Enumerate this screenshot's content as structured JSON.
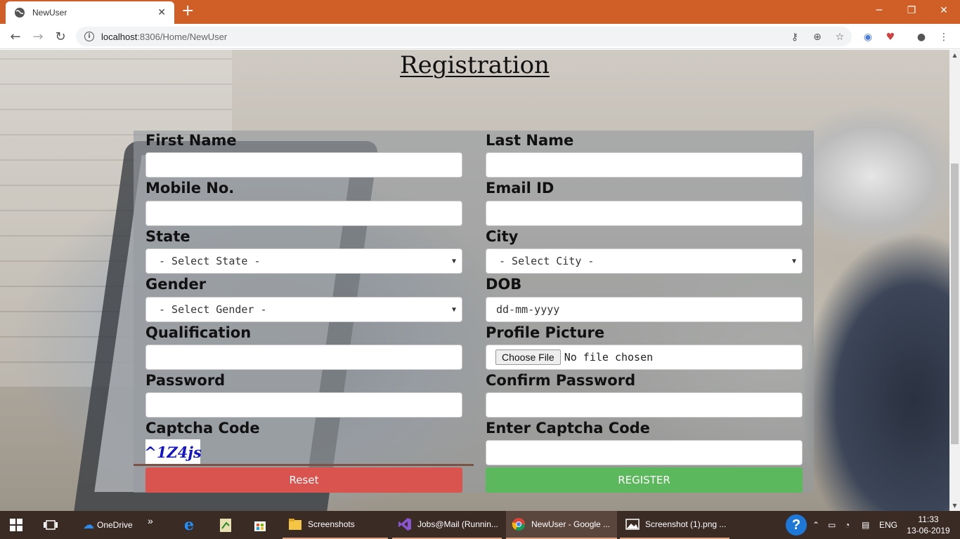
{
  "browser": {
    "tab_title": "NewUser",
    "tab_close": "✕",
    "new_tab": "+",
    "url_host": "localhost",
    "url_path": ":8306/Home/NewUser",
    "window_controls": {
      "minimize": "─",
      "restore": "❐",
      "close": "✕"
    }
  },
  "page": {
    "heading": "Registration",
    "form": {
      "first_name_label": "First Name",
      "last_name_label": "Last Name",
      "mobile_label": "Mobile No.",
      "email_label": "Email ID",
      "state_label": "State",
      "state_selected": "- Select State -",
      "city_label": "City",
      "city_selected": "- Select City -",
      "gender_label": "Gender",
      "gender_selected": "- Select Gender -",
      "dob_label": "DOB",
      "dob_placeholder": "dd-mm-yyyy",
      "qualification_label": "Qualification",
      "profile_label": "Profile Picture",
      "file_button": "Choose File",
      "file_status": "No file chosen",
      "password_label": "Password",
      "confirm_password_label": "Confirm Password",
      "captcha_label": "Captcha Code",
      "captcha_value": "^1Z4js",
      "enter_captcha_label": "Enter Captcha Code",
      "reset_button": "Reset",
      "register_button": "REGISTER"
    },
    "colors": {
      "reset": "#d9534f",
      "register": "#5cb85c"
    }
  },
  "taskbar": {
    "onedrive": "OneDrive",
    "overflow": "»",
    "screenshots": "Screenshots",
    "jobs": "Jobs@Mail (Runnin...",
    "chrome": "NewUser - Google ...",
    "photos": "Screenshot (1).png ...",
    "lang": "ENG",
    "time": "11:33",
    "date": "13-06-2019"
  }
}
